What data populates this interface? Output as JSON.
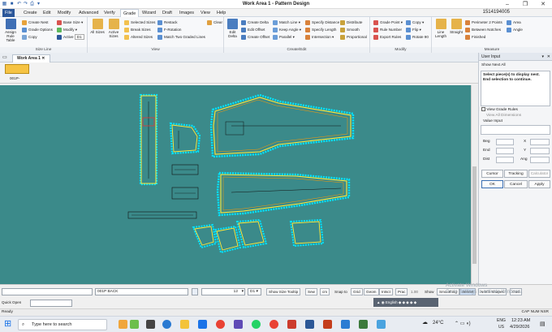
{
  "window": {
    "title": "Work Area 1 - Pattern Design",
    "phone": "1514194005"
  },
  "menu": [
    "File",
    "Create",
    "Edit",
    "Modify",
    "Advanced",
    "Verify",
    "Grade",
    "Wizard",
    "Draft",
    "Images",
    "View",
    "Help"
  ],
  "ribbon": {
    "size_line": {
      "label": "Size Line",
      "assign": "Assign Rule Table",
      "create_nest": "Create Nest",
      "grade_options": "Grade Options",
      "copy": "Copy",
      "base_size": "Base Size",
      "modify": "Modify",
      "active": "Active",
      "active_value": "D1"
    },
    "view": {
      "label": "View",
      "all_sizes": "All Sizes",
      "active_sizes": "Active Sizes",
      "selected_sizes": "Selected Sizes",
      "break_sizes": "Break Sizes",
      "altered_sizes": "Altered Sizes",
      "restack": "Restack",
      "f_rotation": "F-Rotation",
      "match_two": "Match Two Graded Lines",
      "clear": "Clear"
    },
    "create_edit": {
      "label": "Create/Edit",
      "edit_delta": "Edit Delta",
      "create_delta": "Create Delta",
      "edit_offset": "Edit Offset",
      "create_offset": "Create Offset",
      "match_line": "Match Line",
      "keep_angle": "Keep Angle",
      "parallel": "Parallel",
      "specify_distance": "Specify Distance",
      "specify_length": "Specify Length",
      "intersection": "Intersection",
      "distribute": "Distribute",
      "smooth": "Smooth",
      "proportional": "Proportional"
    },
    "modify": {
      "label": "Modify",
      "grade_point": "Grade Point",
      "rule_number": "Rule Number",
      "export_rules": "Export Rules",
      "copy": "Copy",
      "flip": "Flip",
      "rotate90": "Rotate 90"
    },
    "measure": {
      "label": "Measure",
      "line_length": "Line Length",
      "straight": "Straight",
      "perimeter": "Perimeter 2 Points",
      "between_notches": "Between Notches",
      "finished": "Finished",
      "area": "Area",
      "angle": "Angle"
    }
  },
  "doc_tab": "Work Area 1",
  "piece_label": "001P-",
  "panel": {
    "title": "User Input",
    "show_next_all": "Show Next All",
    "prompt_line1": "Select piece(s) to display nest.",
    "prompt_line2": "End selection to continue.",
    "view_grade_rules": "View Grade Rules",
    "view_all_dimensions": "View All Dimensions",
    "value_input": "Value Input",
    "beg": "Beg",
    "end": "End",
    "dist": "Dist",
    "x": "X",
    "y": "Y",
    "ang": "Ang",
    "cursor": "Cursor",
    "tracking": "Tracking",
    "calculator": "Calculator",
    "ok": "OK",
    "cancel": "Cancel",
    "apply": "Apply"
  },
  "toolbar": {
    "piece_name": "001P BACK",
    "size_value": "12",
    "size_code": "D1",
    "show_size_tooltip": "Show Size Tooltip",
    "sew": "Sew",
    "cm": "cm",
    "snap_to": "Snap to",
    "grid": "Grid",
    "geom": "Geom",
    "intsct": "Intsct",
    "prac": "Prac",
    "snap_value": "1.00",
    "show": "Show",
    "smoothing": "Smoothing",
    "seams": "Seams",
    "notch_shapes": "Notch Shapes",
    "grid2": "Grid"
  },
  "quick_open": "Quick Open",
  "status": {
    "ready": "Ready",
    "caps": "CAP NUM NSR"
  },
  "watermark": {
    "line1": "Activate Windows",
    "line2": "Go to Settings to activate Windows."
  },
  "taskbar": {
    "search": "Type here to search",
    "weather": "24°C",
    "lang": "ENG",
    "region": "US",
    "time": "12:23 AM",
    "date": "4/29/2026"
  },
  "colors": {
    "canvas": "#3b8a8a",
    "file_tab": "#2b579a",
    "grade_lines": "#ffeb3b"
  }
}
